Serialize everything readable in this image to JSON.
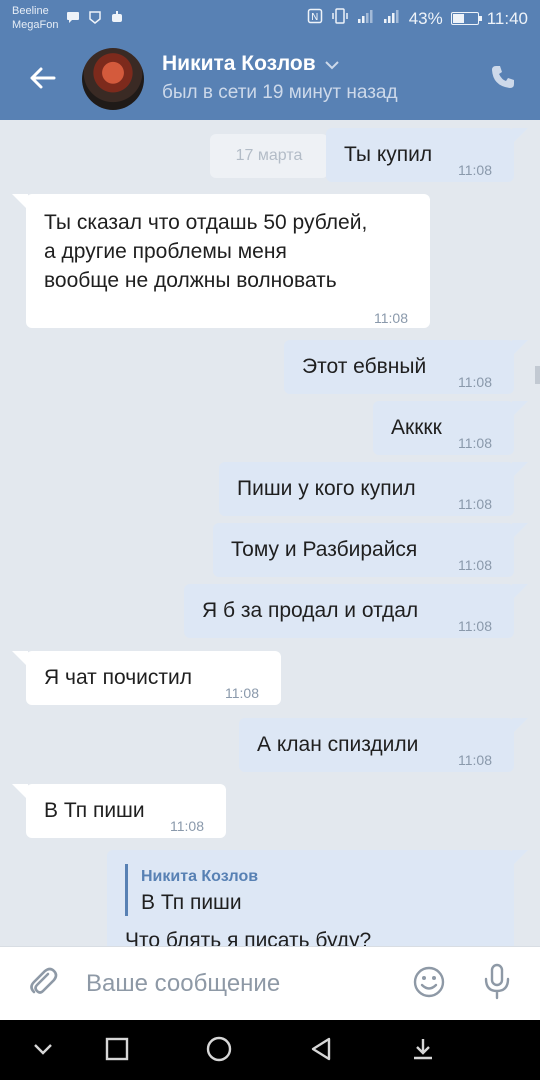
{
  "status_bar": {
    "carrier_1": "Beeline",
    "carrier_2": "MegaFon",
    "battery": "43%",
    "battery_level": 0.43,
    "time": "11:40"
  },
  "header": {
    "contact_name": "Никита Козлов",
    "last_seen": "был в сети 19 минут назад",
    "accent_color": "#5881b4"
  },
  "chat": {
    "date_separator": "17 марта",
    "messages": [
      {
        "direction": "out",
        "text": "Ты купил",
        "time": "11:08"
      },
      {
        "direction": "in",
        "lines": [
          "Ты сказал что отдашь 50 рублей,",
          "а другие проблемы меня",
          "вообще не должны волновать"
        ],
        "time": "11:08"
      },
      {
        "direction": "out",
        "text": "Этот ебвный",
        "time": "11:08"
      },
      {
        "direction": "out",
        "text": "Акккк",
        "time": "11:08"
      },
      {
        "direction": "out",
        "text": "Пиши у кого купил",
        "time": "11:08"
      },
      {
        "direction": "out",
        "text": "Тому и Разбирайся",
        "time": "11:08"
      },
      {
        "direction": "out",
        "text": "Я б за продал и отдал",
        "time": "11:08"
      },
      {
        "direction": "in",
        "text": "Я чат почистил",
        "time": "11:08"
      },
      {
        "direction": "out",
        "text": "А клан спиздили",
        "time": "11:08"
      },
      {
        "direction": "in",
        "text": "В Тп пиши",
        "time": "11:08"
      },
      {
        "direction": "out",
        "reply_to_name": "Никита Козлов",
        "reply_to_text": "В Тп пиши",
        "text": "Что блять я писать буду?"
      }
    ]
  },
  "composer": {
    "placeholder": "Ваше сообщение"
  },
  "icons": {
    "back": "arrow-left-icon",
    "call": "phone-icon",
    "attach": "paperclip-icon",
    "emoji": "smiley-icon",
    "mic": "microphone-icon"
  }
}
